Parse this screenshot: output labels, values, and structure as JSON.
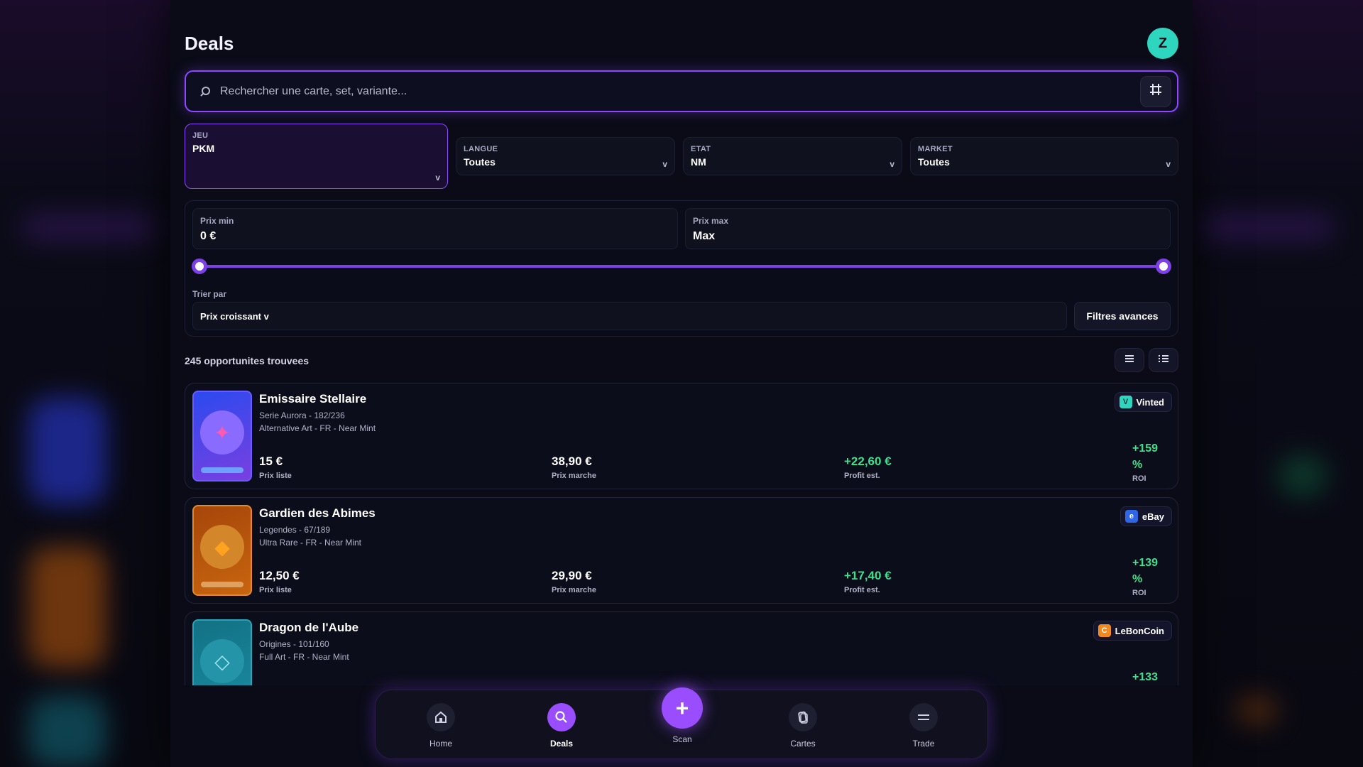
{
  "header": {
    "title": "Deals",
    "avatar_initial": "Z"
  },
  "search": {
    "placeholder": "Rechercher une carte, set, variante..."
  },
  "filters": [
    {
      "label": "JEU",
      "value": "PKM",
      "active": true
    },
    {
      "label": "LANGUE",
      "value": "Toutes",
      "active": false
    },
    {
      "label": "ETAT",
      "value": "NM",
      "active": false
    },
    {
      "label": "MARKET",
      "value": "Toutes",
      "active": false
    }
  ],
  "chevron": "v",
  "price": {
    "min_label": "Prix min",
    "min_value": "0 €",
    "max_label": "Prix max",
    "max_value": "Max",
    "sort_label": "Trier par",
    "sort_value": "Prix croissant v",
    "advanced_label": "Filtres avances"
  },
  "results": {
    "count_text": "245 opportunites trouvees"
  },
  "deals": [
    {
      "name": "Emissaire Stellaire",
      "set": "Serie Aurora - 182/236",
      "variant": "Alternative Art - FR - Near Mint",
      "list_price": "15 €",
      "list_label": "Prix liste",
      "market_price": "38,90 €",
      "market_label": "Prix marche",
      "profit": "+22,60 €",
      "profit_label": "Profit est.",
      "roi_value": "+159",
      "roi_pct": "%",
      "roi_label": "ROI",
      "market": "Vinted",
      "market_icon_letter": "V",
      "market_color": "#2fd6bf",
      "thumb_icon": "star-icon",
      "thumb_glyph": "✦",
      "thumb_bg": "#3b2fd6",
      "thumb_accent": "#9b7bff",
      "thumb_glyph_color": "#ff5ab0"
    },
    {
      "name": "Gardien des Abimes",
      "set": "Legendes - 67/189",
      "variant": "Ultra Rare - FR - Near Mint",
      "list_price": "12,50 €",
      "list_label": "Prix liste",
      "market_price": "29,90 €",
      "market_label": "Prix marche",
      "profit": "+17,40 €",
      "profit_label": "Profit est.",
      "roi_value": "+139",
      "roi_pct": "%",
      "roi_label": "ROI",
      "market": "eBay",
      "market_icon_letter": "e",
      "market_color": "#2f66e8",
      "thumb_icon": "diamond-icon",
      "thumb_glyph": "◆",
      "thumb_bg": "#b5520c",
      "thumb_accent": "#e28a2b",
      "thumb_glyph_color": "#ffa21f"
    },
    {
      "name": "Dragon de l'Aube",
      "set": "Origines - 101/160",
      "variant": "Full Art - FR - Near Mint",
      "list_price": "",
      "list_label": "",
      "market_price": "",
      "market_label": "",
      "profit": "",
      "profit_label": "",
      "roi_value": "+133",
      "roi_pct": "",
      "roi_label": "",
      "market": "LeBonCoin",
      "market_icon_letter": "C",
      "market_color": "#f08a1f",
      "thumb_icon": "diamond-outline-icon",
      "thumb_glyph": "◇",
      "thumb_bg": "#1a7f93",
      "thumb_accent": "#2aa3b8",
      "thumb_glyph_color": "#9fe6f2"
    }
  ],
  "nav": {
    "home": "Home",
    "deals": "Deals",
    "scan": "Scan",
    "cards": "Cartes",
    "trade": "Trade",
    "scan_glyph": "+"
  }
}
